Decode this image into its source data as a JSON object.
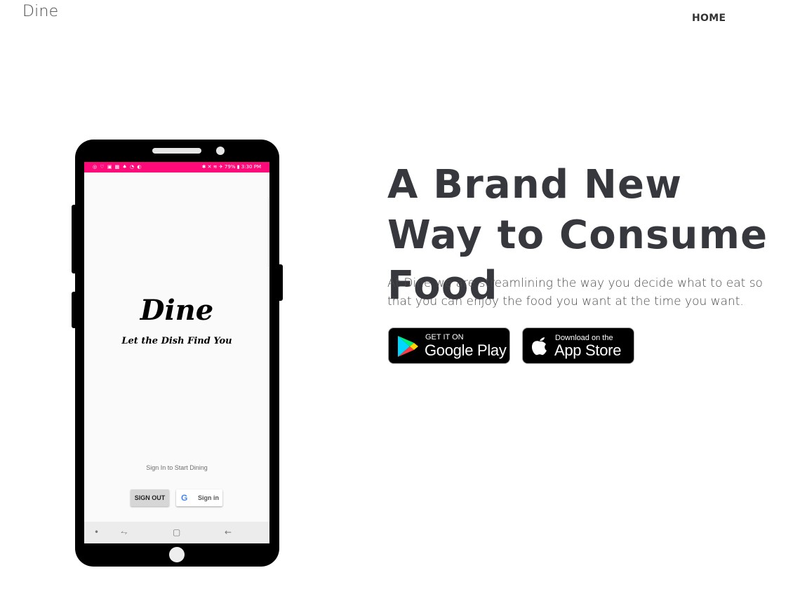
{
  "header": {
    "brand": "Dine",
    "nav": {
      "home": "HOME"
    }
  },
  "phone": {
    "status": {
      "left_icons": "◎ ♡ ▣ ▩ ♠ ◔ ◐",
      "right": "✱ ✕ ≋ ✈ 79% ▮ 3:30 PM"
    },
    "app_title": "Dine",
    "app_tagline": "Let the Dish Find You",
    "signin_prompt": "Sign In to Start Dining",
    "signout_label": "SIGN OUT",
    "google_signin_label": "Sign in",
    "google_letter": "G",
    "navbar": {
      "dot": "•",
      "recents": "⥊",
      "home": "▢",
      "back": "←"
    }
  },
  "hero": {
    "title": "A Brand New Way to Consume Food",
    "description": "At Dine we are streamlining the way you decide what to eat so that you can enjoy the food you want at the time you want.",
    "google_play": {
      "small": "GET IT ON",
      "big": "Google Play"
    },
    "app_store": {
      "small": "Download on the",
      "big": "App Store"
    }
  },
  "colors": {
    "accent": "#ff0a78",
    "heading": "#36383d",
    "text": "#4a4a4a"
  },
  "icons": [
    "google-play-icon",
    "apple-icon",
    "google-g-icon"
  ]
}
